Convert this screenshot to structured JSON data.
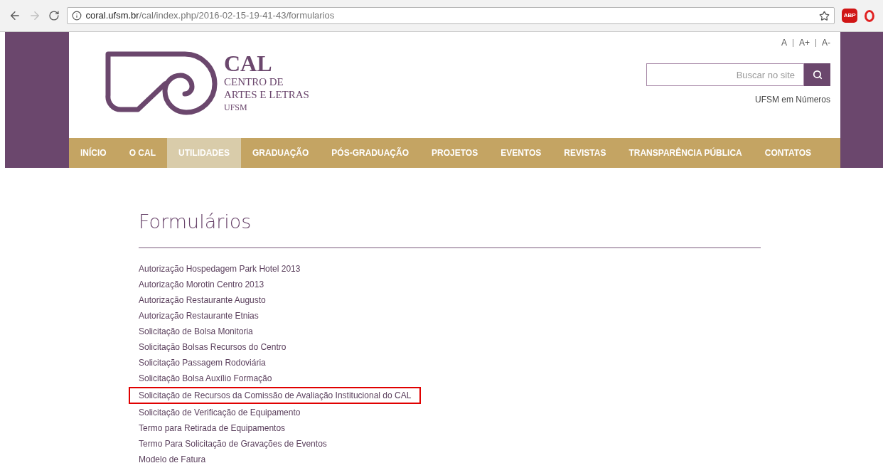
{
  "browser": {
    "url_host": "coral.ufsm.br",
    "url_path": "/cal/index.php/2016-02-15-19-41-43/formularios",
    "extension_badge": "ABP"
  },
  "header": {
    "logo_title": "CAL",
    "logo_lines": [
      "CENTRO DE",
      "ARTES E LETRAS",
      "UFSM"
    ],
    "font_size_controls": [
      "A",
      "A+",
      "A-"
    ],
    "search": {
      "placeholder": "Buscar no site"
    },
    "link": "UFSM em Números"
  },
  "nav": [
    {
      "label": "INÍCIO",
      "selected": false
    },
    {
      "label": "O CAL",
      "selected": false
    },
    {
      "label": "UTILIDADES",
      "selected": true
    },
    {
      "label": "GRADUAÇÃO",
      "selected": false
    },
    {
      "label": "PÓS-GRADUAÇÃO",
      "selected": false
    },
    {
      "label": "PROJETOS",
      "selected": false
    },
    {
      "label": "EVENTOS",
      "selected": false
    },
    {
      "label": "REVISTAS",
      "selected": false
    },
    {
      "label": "TRANSPARÊNCIA PÚBLICA",
      "selected": false
    },
    {
      "label": "CONTATOS",
      "selected": false
    }
  ],
  "page": {
    "title": "Formulários",
    "links": [
      {
        "label": "Autorização Hospedagem Park Hotel 2013",
        "highlighted": false
      },
      {
        "label": "Autorização Morotin Centro 2013",
        "highlighted": false
      },
      {
        "label": "Autorização Restaurante Augusto",
        "highlighted": false
      },
      {
        "label": "Autorização Restaurante Etnias",
        "highlighted": false
      },
      {
        "label": "Solicitação de Bolsa Monitoria",
        "highlighted": false
      },
      {
        "label": "Solicitação Bolsas Recursos do Centro",
        "highlighted": false
      },
      {
        "label": "Solicitação Passagem Rodoviária",
        "highlighted": false
      },
      {
        "label": "Solicitação Bolsa Auxílio Formação",
        "highlighted": false
      },
      {
        "label": "Solicitação de Recursos da Comissão de Avaliação Institucional do CAL",
        "highlighted": true
      },
      {
        "label": "Solicitação de Verificação de Equipamento",
        "highlighted": false
      },
      {
        "label": "Termo para Retirada de Equipamentos",
        "highlighted": false
      },
      {
        "label": "Termo Para Solicitação de Gravações de Eventos",
        "highlighted": false
      },
      {
        "label": "Modelo de Fatura",
        "highlighted": false
      }
    ]
  }
}
